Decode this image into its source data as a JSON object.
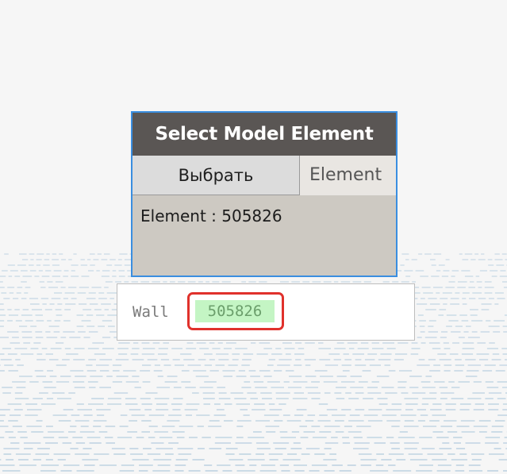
{
  "colors": {
    "header_bg": "#5a5654",
    "node_border": "#3a8ee0",
    "node_body_bg": "#cdc9c2",
    "highlight_border": "#e0312c",
    "value_bg": "#c4f5c4",
    "grid_pattern": "#b8cfe0"
  },
  "node": {
    "title": "Select Model Element",
    "select_button_label": "Выбрать",
    "output_port_label": "Element",
    "body_text": "Element : 505826"
  },
  "preview": {
    "type_label": "Wall",
    "value": "505826"
  }
}
